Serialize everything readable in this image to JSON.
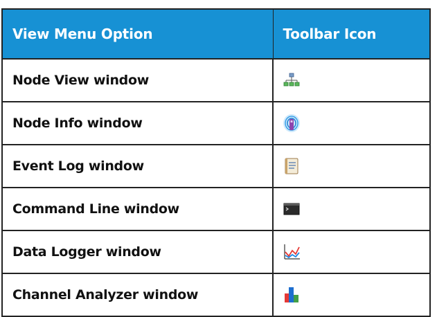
{
  "header": {
    "col1": "View Menu Option",
    "col2": "Toolbar Icon"
  },
  "rows": [
    {
      "option": "Node View window",
      "icon": "node-view-icon"
    },
    {
      "option": "Node Info window",
      "icon": "node-info-icon"
    },
    {
      "option": "Event Log window",
      "icon": "event-log-icon"
    },
    {
      "option": "Command Line window",
      "icon": "command-line-icon"
    },
    {
      "option": "Data Logger window",
      "icon": "data-logger-icon"
    },
    {
      "option": "Channel Analyzer window",
      "icon": "channel-analyzer-icon"
    }
  ],
  "colors": {
    "header_bg": "#1791d4",
    "header_text": "#ffffff"
  }
}
